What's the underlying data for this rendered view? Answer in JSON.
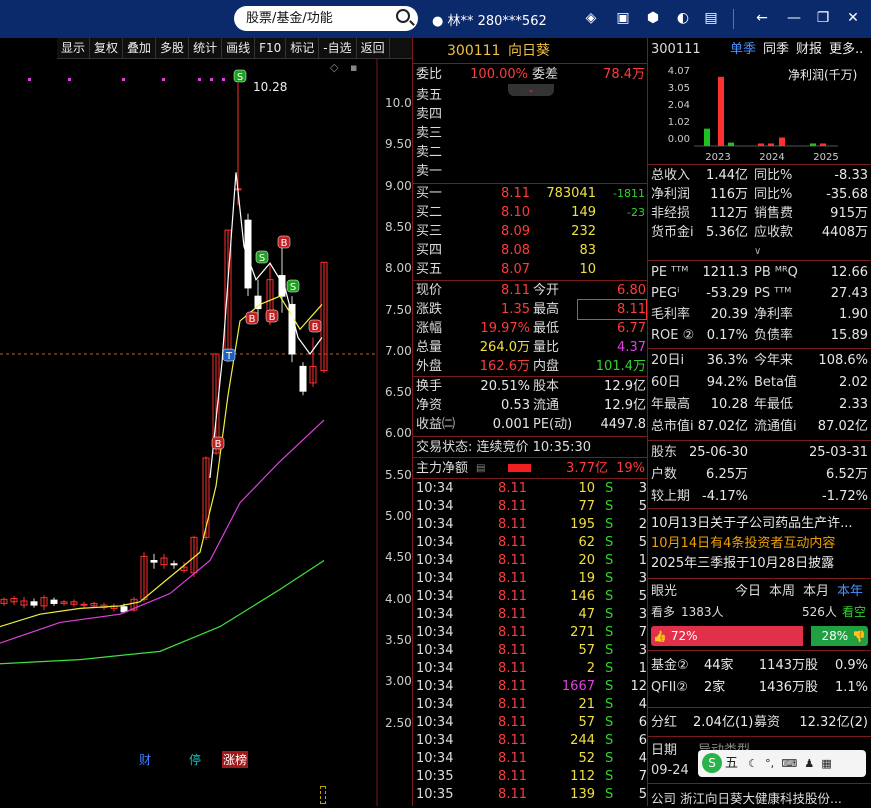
{
  "top": {
    "search": "股票/基金/功能",
    "user": "林**  280***562"
  },
  "toolbar": [
    "显示",
    "复权",
    "叠加",
    "多股",
    "统计",
    "画线",
    "F10",
    "标记",
    "-自选",
    "返回"
  ],
  "chart": {
    "high_label": "10.28",
    "yticks": [
      "10.00",
      "9.50",
      "9.00",
      "8.50",
      "8.00",
      "7.50",
      "7.00",
      "6.50",
      "6.00",
      "5.50",
      "5.00",
      "4.50",
      "4.00",
      "3.50",
      "3.00",
      "2.50"
    ],
    "markers": [
      "财",
      "停",
      "涨榜"
    ]
  },
  "quote": {
    "code": "300111",
    "name": "向日葵",
    "wb_label": "委比",
    "wb": "100.00%",
    "wc_label": "委差",
    "wc": "78.4万",
    "sells": [
      "卖五",
      "卖四",
      "卖三",
      "卖二",
      "卖一"
    ],
    "buys": [
      {
        "l": "买一",
        "p": "8.11",
        "v": "783041",
        "d": "-1811"
      },
      {
        "l": "买二",
        "p": "8.10",
        "v": "149",
        "d": "-23"
      },
      {
        "l": "买三",
        "p": "8.09",
        "v": "232",
        "d": ""
      },
      {
        "l": "买四",
        "p": "8.08",
        "v": "83",
        "d": ""
      },
      {
        "l": "买五",
        "p": "8.07",
        "v": "10",
        "d": ""
      }
    ],
    "stats": [
      [
        "现价",
        "8.11",
        "今开",
        "6.80"
      ],
      [
        "涨跌",
        "1.35",
        "最高",
        "8.11"
      ],
      [
        "涨幅",
        "19.97%",
        "最低",
        "6.77"
      ],
      [
        "总量",
        "264.0万",
        "量比",
        "4.37"
      ],
      [
        "外盘",
        "162.6万",
        "内盘",
        "101.4万"
      ]
    ],
    "stats2": [
      [
        "换手",
        "20.51%",
        "股本",
        "12.9亿"
      ],
      [
        "净资",
        "0.53",
        "流通",
        "12.9亿"
      ],
      [
        "收益㈡",
        "0.001",
        "PE(动)",
        "4497.8"
      ]
    ],
    "status": "交易状态: 连续竞价 10:35:30",
    "flow_label": "主力净额",
    "flow": "3.77亿",
    "flow_pct": "19%",
    "ticks": [
      [
        "10:34",
        "8.11",
        "10",
        "S",
        "3"
      ],
      [
        "10:34",
        "8.11",
        "77",
        "S",
        "5"
      ],
      [
        "10:34",
        "8.11",
        "195",
        "S",
        "2"
      ],
      [
        "10:34",
        "8.11",
        "62",
        "S",
        "5"
      ],
      [
        "10:34",
        "8.11",
        "20",
        "S",
        "1"
      ],
      [
        "10:34",
        "8.11",
        "19",
        "S",
        "3"
      ],
      [
        "10:34",
        "8.11",
        "146",
        "S",
        "5"
      ],
      [
        "10:34",
        "8.11",
        "47",
        "S",
        "3"
      ],
      [
        "10:34",
        "8.11",
        "271",
        "S",
        "7"
      ],
      [
        "10:34",
        "8.11",
        "57",
        "S",
        "3"
      ],
      [
        "10:34",
        "8.11",
        "2",
        "S",
        "1"
      ],
      [
        "10:34",
        "8.11",
        "1667",
        "S",
        "12"
      ],
      [
        "10:34",
        "8.11",
        "21",
        "S",
        "4"
      ],
      [
        "10:34",
        "8.11",
        "57",
        "S",
        "6"
      ],
      [
        "10:34",
        "8.11",
        "244",
        "S",
        "6"
      ],
      [
        "10:34",
        "8.11",
        "52",
        "S",
        "4"
      ],
      [
        "10:35",
        "8.11",
        "112",
        "S",
        "7"
      ],
      [
        "10:35",
        "8.11",
        "139",
        "S",
        "5"
      ]
    ]
  },
  "fin": {
    "code": "300111",
    "tabs": [
      "单季",
      "同季",
      "财报",
      "更多.."
    ],
    "chart_title": "净利润(千万)",
    "yvals": [
      "4.07",
      "3.05",
      "2.04",
      "1.02",
      "0.00"
    ],
    "years": [
      "2023",
      "2024",
      "2025"
    ],
    "rows1": [
      [
        "总收入",
        "1.44亿",
        "同比%",
        "-8.33"
      ],
      [
        "净利润",
        "116万",
        "同比%",
        "-35.68"
      ],
      [
        "非经损",
        "112万",
        "销售费",
        "915万"
      ],
      [
        "货币金i",
        "5.36亿",
        "应收款",
        "4408万"
      ]
    ],
    "rows2": [
      [
        "PE ᵀᵀᴹ",
        "1211.3",
        "PB ᴹᴿQ",
        "12.66"
      ],
      [
        "PEGⁱ",
        "-53.29",
        "PS ᵀᵀᴹ",
        "27.43"
      ],
      [
        "毛利率",
        "20.39",
        "净利率",
        "1.90"
      ],
      [
        "ROE ②",
        "0.17%",
        "负债率",
        "15.89"
      ]
    ],
    "rows3": [
      [
        "20日i",
        "36.3%",
        "今年来",
        "108.6%"
      ],
      [
        "60日",
        "94.2%",
        "Beta值",
        "2.02"
      ],
      [
        "年最高",
        "10.28",
        "年最低",
        "2.33"
      ],
      [
        "总市值i",
        "87.02亿",
        "流通值i",
        "87.02亿"
      ]
    ],
    "holders": [
      [
        "股东",
        "25-06-30",
        "",
        "25-03-31"
      ],
      [
        "户数",
        "6.25万",
        "",
        "6.52万"
      ],
      [
        "较上期",
        "-4.17%",
        "",
        "-1.72%"
      ]
    ],
    "news": [
      "10月13日关于子公司药品生产许...",
      "10月14日有4条投资者互动内容",
      "2025年三季报于10月28日披露"
    ],
    "sent": {
      "label": "眼光",
      "tabs": [
        "今日",
        "本周",
        "本月",
        "本年"
      ],
      "bull_label": "看多",
      "bull_n": "1383人",
      "bear_n": "526人",
      "bear_label": "看空",
      "bull_pct": "72%",
      "bear_pct": "28%"
    },
    "fund": [
      [
        "基金②",
        "44家",
        "1143万股",
        "0.9%"
      ],
      [
        "QFII②",
        "2家",
        "1436万股",
        "1.1%"
      ]
    ],
    "div": [
      "分红",
      "2.04亿(1)",
      "募资",
      "12.32亿(2)"
    ],
    "date_label": "日期",
    "date": "09-24",
    "type_label": "异动类型",
    "company": "公司  浙江向日葵大健康科技股份..."
  },
  "ime": {
    "label": "五"
  }
}
